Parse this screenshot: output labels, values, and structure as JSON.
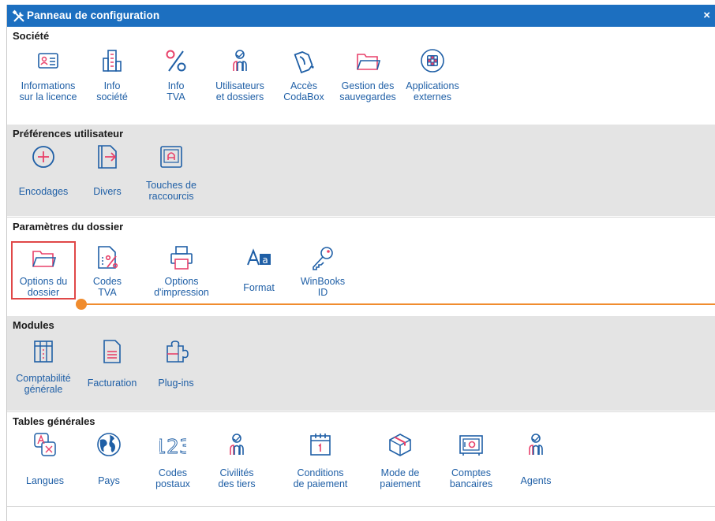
{
  "window": {
    "title": "Panneau de configuration",
    "close": "×",
    "accent": "#1c6fc0",
    "icon_color": "#e8416a",
    "link_color": "#1f5fa6",
    "highlight_color": "#e04848",
    "slider_color": "#f08c2e"
  },
  "sections": {
    "societe": {
      "title": "Société",
      "items": [
        {
          "label": "Informations\nsur la licence",
          "icon": "id-card-icon"
        },
        {
          "label": "Info\nsociété",
          "icon": "building-icon"
        },
        {
          "label": "Info\nTVA",
          "icon": "percent-icon"
        },
        {
          "label": "Utilisateurs\net dossiers",
          "icon": "users-icon"
        },
        {
          "label": "Accès\nCodaBox",
          "icon": "codabox-icon"
        },
        {
          "label": "Gestion des\nsauvegardes",
          "icon": "folder-icon"
        },
        {
          "label": "Applications\nexternes",
          "icon": "apps-grid-icon"
        }
      ]
    },
    "preferences": {
      "title": "Préférences utilisateur",
      "items": [
        {
          "label": "Encodages",
          "icon": "plus-circle-icon"
        },
        {
          "label": "Divers",
          "icon": "export-icon"
        },
        {
          "label": "Touches de\nraccourcis",
          "icon": "keyboard-key-icon"
        }
      ]
    },
    "parametres": {
      "title": "Paramètres du dossier",
      "items": [
        {
          "label": "Options du\ndossier",
          "icon": "folder-icon"
        },
        {
          "label": "Codes\nTVA",
          "icon": "vat-file-icon"
        },
        {
          "label": "Options\nd'impression",
          "icon": "printer-icon"
        },
        {
          "label": "Format",
          "icon": "font-format-icon"
        },
        {
          "label": "WinBooks\nID",
          "icon": "key-icon"
        }
      ]
    },
    "modules": {
      "title": "Modules",
      "items": [
        {
          "label": "Comptabilité\ngénérale",
          "icon": "ledger-icon"
        },
        {
          "label": "Facturation",
          "icon": "invoice-icon"
        },
        {
          "label": "Plug-ins",
          "icon": "puzzle-icon"
        }
      ]
    },
    "tables": {
      "title": "Tables générales",
      "items": [
        {
          "label": "Langues",
          "icon": "translate-icon"
        },
        {
          "label": "Pays",
          "icon": "globe-icon"
        },
        {
          "label": "Codes\npostaux",
          "icon": "numbers-icon"
        },
        {
          "label": "Civilités\ndes tiers",
          "icon": "users-icon"
        },
        {
          "label": "Conditions\nde paiement",
          "icon": "calendar-icon"
        },
        {
          "label": "Mode de\npaiement",
          "icon": "package-icon"
        },
        {
          "label": "Comptes\nbancaires",
          "icon": "safe-icon"
        },
        {
          "label": "Agents",
          "icon": "users-icon"
        }
      ]
    }
  }
}
